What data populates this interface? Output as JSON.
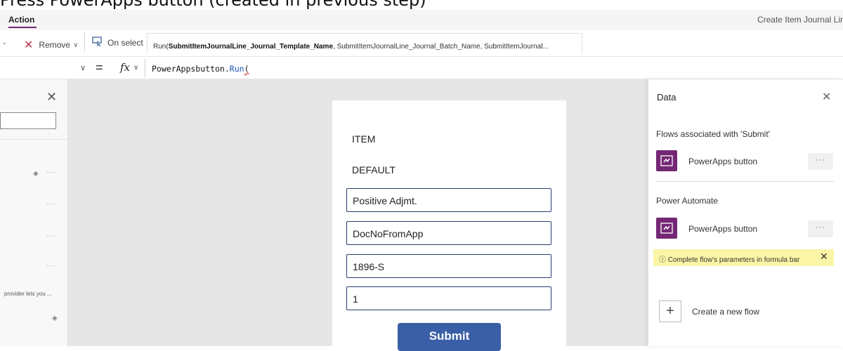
{
  "caption": "Press PowerApps button (created in previous step)",
  "menubar": {
    "action_tab": "Action",
    "create_title": "Create Item Journal Lir"
  },
  "toolbar": {
    "remove_label": "Remove",
    "on_select_label": "On select",
    "formula_preview_prefix": "Run(",
    "formula_preview_bold": "SubmitItemJournalLine_Journal_Template_Name",
    "formula_preview_rest": ", SubmitItemJournalLine_Journal_Batch_Name, SubmitItemJournal..."
  },
  "formula_bar": {
    "equals": "=",
    "fx": "fx",
    "object": "PowerAppsbutton.",
    "function": "Run",
    "paren": "("
  },
  "left_panel": {
    "text_snippet": "provider lets you ...",
    "dots": "···"
  },
  "form": {
    "label_item": "ITEM",
    "label_default": "DEFAULT",
    "field_1": "Positive Adjmt.",
    "field_2": "DocNoFromApp",
    "field_3": "1896-S",
    "field_4": "1",
    "submit_label": "Submit"
  },
  "data_panel": {
    "title": "Data",
    "section_associated": "Flows associated with 'Submit'",
    "flow_1": "PowerApps button",
    "section_power_automate": "Power Automate",
    "flow_2": "PowerApps button",
    "more": "···",
    "warning": "Complete flow's parameters in formula bar",
    "new_flow": "Create a new flow"
  },
  "colors": {
    "brand": "#742774",
    "submit": "#3a5fa6",
    "warning_bg": "#fbf5a6",
    "error": "#d13438"
  }
}
